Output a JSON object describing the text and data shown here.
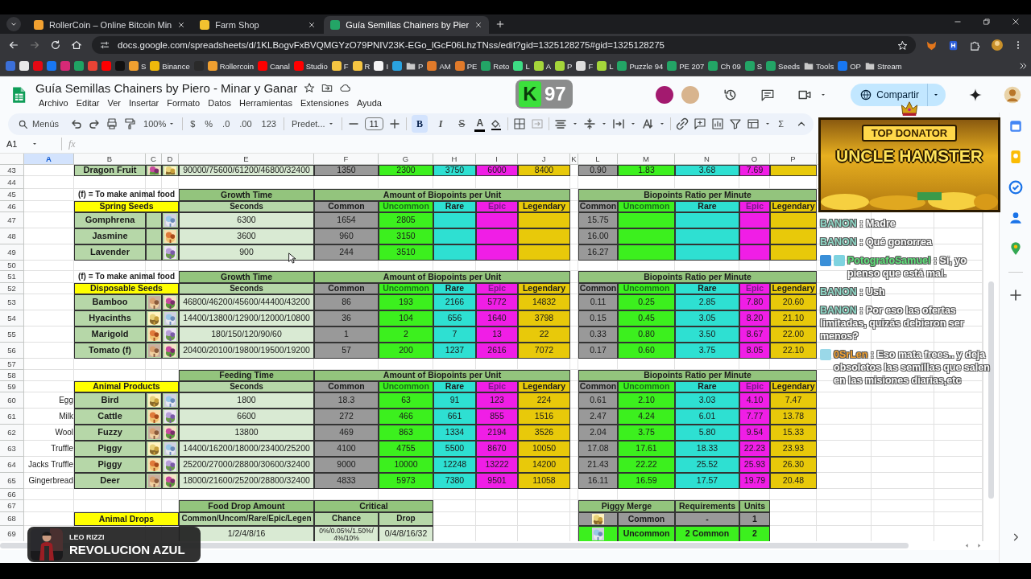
{
  "browser": {
    "tabs": [
      {
        "title": "RollerCoin – Online Bitcoin Min",
        "color": "#f0a030",
        "selected": false
      },
      {
        "title": "Farm Shop",
        "color": "#f2c230",
        "selected": false
      },
      {
        "title": "Guía Semillas Chainers by Pier",
        "color": "#23a566",
        "selected": true
      }
    ],
    "url": "docs.google.com/spreadsheets/d/1KLBogvFxBVQMGYzO79PNIV23K-EGo_lGcF06LhzTNss/edit?gid=1325128275#gid=1325128275",
    "bookmarks": [
      {
        "kind": "site",
        "color": "#3b6fd8"
      },
      {
        "kind": "site",
        "color": "#e8e8e8"
      },
      {
        "kind": "site",
        "color": "#e50914"
      },
      {
        "kind": "site",
        "color": "#1877f2"
      },
      {
        "kind": "site",
        "color": "#d62976"
      },
      {
        "kind": "site",
        "color": "#1fa463"
      },
      {
        "kind": "site",
        "color": "#ea4335"
      },
      {
        "kind": "site",
        "color": "#ff0000"
      },
      {
        "kind": "site",
        "color": "#111111"
      },
      {
        "kind": "site",
        "color": "#f0a030",
        "label": "S"
      },
      {
        "kind": "site",
        "color": "#f0b90b",
        "label": "Binance"
      },
      {
        "kind": "site",
        "color": "#2a2a2a"
      },
      {
        "kind": "site",
        "color": "#f0a030",
        "label": "Rollercoin"
      },
      {
        "kind": "site",
        "color": "#ff0000",
        "label": "Canal"
      },
      {
        "kind": "site",
        "color": "#ff0000",
        "label": "Studio"
      },
      {
        "kind": "site",
        "color": "#f5c542",
        "label": "F"
      },
      {
        "kind": "site",
        "color": "#f5c542",
        "label": "R"
      },
      {
        "kind": "site",
        "color": "#f4f4f4",
        "label": "I"
      },
      {
        "kind": "site",
        "color": "#2aa3e0"
      },
      {
        "kind": "folder",
        "color": "#c8c8c8",
        "label": "P"
      },
      {
        "kind": "site",
        "color": "#e07a2a",
        "label": "AM"
      },
      {
        "kind": "site",
        "color": "#e07a2a",
        "label": "PE"
      },
      {
        "kind": "site",
        "color": "#23a566",
        "label": "Reto"
      },
      {
        "kind": "site",
        "color": "#3ddc84",
        "label": "L"
      },
      {
        "kind": "site",
        "color": "#a5d63a",
        "label": "A"
      },
      {
        "kind": "site",
        "color": "#a5d63a",
        "label": "P"
      },
      {
        "kind": "site",
        "color": "#dddddd",
        "label": "F"
      },
      {
        "kind": "site",
        "color": "#a5d63a",
        "label": "L"
      },
      {
        "kind": "site",
        "color": "#23a566",
        "label": "Puzzle 94"
      },
      {
        "kind": "site",
        "color": "#23a566",
        "label": "PE 207"
      },
      {
        "kind": "site",
        "color": "#23a566",
        "label": "Ch 09"
      },
      {
        "kind": "site",
        "color": "#23a566",
        "label": "S"
      },
      {
        "kind": "site",
        "color": "#23a566",
        "label": "Seeds"
      },
      {
        "kind": "folder",
        "color": "#c8c8c8",
        "label": "Tools"
      },
      {
        "kind": "site",
        "color": "#1877f2",
        "label": "OP"
      },
      {
        "kind": "folder",
        "color": "#c8c8c8",
        "label": "Stream"
      }
    ]
  },
  "document": {
    "title": "Guía Semillas Chainers by Piero - Minar y Ganar",
    "menus": [
      "Archivo",
      "Editar",
      "Ver",
      "Insertar",
      "Formato",
      "Datos",
      "Herramientas",
      "Extensiones",
      "Ayuda"
    ],
    "collaborators": [
      {
        "color": "#a31a6f"
      },
      {
        "color": "#d8b48e"
      }
    ],
    "share": "Compartir"
  },
  "toolbar": {
    "search": "Menús",
    "zoom": "100%",
    "number_formats": [
      "$",
      "%",
      ".0",
      ".00",
      "123"
    ],
    "font": "Predet...",
    "font_size": "11",
    "styles": [
      {
        "label": "B",
        "selected": true
      },
      {
        "label": "I",
        "selected": false
      },
      {
        "label": "S",
        "selected": false
      },
      {
        "label": "A",
        "selected": false
      }
    ],
    "functions": "Σ"
  },
  "formula_bar": {
    "cell": "A1",
    "fx": "fx"
  },
  "sheet": {
    "columns": [
      {
        "letter": "A",
        "selected": true
      },
      {
        "letter": "B",
        "selected": false
      },
      {
        "letter": "C",
        "selected": false
      },
      {
        "letter": "D",
        "selected": false
      },
      {
        "letter": "E",
        "selected": false
      },
      {
        "letter": "F",
        "selected": false
      },
      {
        "letter": "G",
        "selected": false
      },
      {
        "letter": "H",
        "selected": false
      },
      {
        "letter": "I",
        "selected": false
      },
      {
        "letter": "J",
        "selected": false
      },
      {
        "letter": "K",
        "selected": false
      },
      {
        "letter": "L",
        "selected": false
      },
      {
        "letter": "M",
        "selected": false
      },
      {
        "letter": "N",
        "selected": false
      },
      {
        "letter": "O",
        "selected": false
      },
      {
        "letter": "P",
        "selected": false
      }
    ],
    "rows": [
      {
        "number": "43",
        "cells": [
          {
            "kind": "blank"
          },
          {
            "text": "Dragon Fruit",
            "kind": "name"
          },
          {
            "kind": "picture"
          },
          {
            "kind": "picture"
          },
          {
            "text": "90000/75600/61200/46800/32400",
            "kind": "val"
          },
          {
            "text": "1350",
            "kind": "common"
          },
          {
            "text": "2300",
            "kind": "uncommon"
          },
          {
            "text": "3750",
            "kind": "rare"
          },
          {
            "text": "6000",
            "kind": "epic"
          },
          {
            "text": "8400",
            "kind": "legendary"
          },
          {
            "kind": "blank"
          },
          {
            "text": "0.90",
            "kind": "common"
          },
          {
            "text": "1.83",
            "kind": "uncommon"
          },
          {
            "text": "3.68",
            "kind": "rare"
          },
          {
            "text": "7.69",
            "kind": "epic"
          },
          {
            "kind": "legendary"
          }
        ]
      },
      {
        "number": "44"
      },
      {
        "number": "45",
        "cells": [
          {
            "kind": "blank"
          },
          {
            "text": "(f) = To make animal food",
            "kind": "note"
          },
          {
            "kind": "merged"
          },
          {
            "kind": "merged"
          },
          {
            "text": "Growth Time",
            "kind": "title"
          },
          {
            "text": "Amount of Biopoints per Unit",
            "kind": "title"
          },
          {
            "kind": "merged"
          },
          {
            "kind": "merged"
          },
          {
            "kind": "merged"
          },
          {
            "kind": "merged"
          },
          {
            "kind": "blank"
          },
          {
            "text": "Biopoints Ratio per Minute",
            "kind": "title"
          },
          {
            "kind": "merged"
          },
          {
            "kind": "merged"
          },
          {
            "kind": "merged"
          },
          {
            "kind": "merged"
          }
        ]
      },
      {
        "number": "46",
        "cells": [
          {
            "kind": "blank"
          },
          {
            "text": "Spring Seeds",
            "kind": "yellow"
          },
          {
            "kind": "merged"
          },
          {
            "kind": "merged"
          },
          {
            "text": "Seconds",
            "kind": "sub"
          },
          {
            "text": "Common",
            "kind": "common-head"
          },
          {
            "text": "Uncommon",
            "kind": "uncommon-head"
          },
          {
            "text": "Rare",
            "kind": "rare-head"
          },
          {
            "text": "Epic",
            "kind": "epic-head"
          },
          {
            "text": "Legendary",
            "kind": "legendary-head"
          },
          {
            "kind": "blank"
          },
          {
            "text": "Common",
            "kind": "common-head"
          },
          {
            "text": "Uncommon",
            "kind": "uncommon-head"
          },
          {
            "text": "Rare",
            "kind": "rare-head"
          },
          {
            "text": "Epic",
            "kind": "epic-head"
          },
          {
            "text": "Legendary",
            "kind": "legendary-head"
          }
        ]
      },
      {
        "number": "47",
        "cells": [
          {
            "kind": "blank"
          },
          {
            "text": "Gomphrena",
            "kind": "name"
          },
          {
            "kind": "name"
          },
          {
            "kind": "picture"
          },
          {
            "text": "6300",
            "kind": "val"
          },
          {
            "text": "1654",
            "kind": "common"
          },
          {
            "text": "2805",
            "kind": "uncommon"
          },
          {
            "kind": "rare"
          },
          {
            "kind": "epic"
          },
          {
            "kind": "legendary"
          },
          {
            "kind": "blank"
          },
          {
            "text": "15.75",
            "kind": "common"
          },
          {
            "kind": "uncommon"
          },
          {
            "kind": "rare"
          },
          {
            "kind": "epic"
          },
          {
            "kind": "legendary"
          }
        ]
      },
      {
        "number": "48",
        "cells": [
          {
            "kind": "blank"
          },
          {
            "text": "Jasmine",
            "kind": "name"
          },
          {
            "kind": "name"
          },
          {
            "kind": "picture"
          },
          {
            "text": "3600",
            "kind": "val"
          },
          {
            "text": "960",
            "kind": "common"
          },
          {
            "text": "3150",
            "kind": "uncommon"
          },
          {
            "kind": "rare"
          },
          {
            "kind": "epic"
          },
          {
            "kind": "legendary"
          },
          {
            "kind": "blank"
          },
          {
            "text": "16.00",
            "kind": "common"
          },
          {
            "kind": "uncommon"
          },
          {
            "kind": "rare"
          },
          {
            "kind": "epic"
          },
          {
            "kind": "legendary"
          }
        ]
      },
      {
        "number": "49",
        "cells": [
          {
            "kind": "blank"
          },
          {
            "text": "Lavender",
            "kind": "name"
          },
          {
            "kind": "name"
          },
          {
            "kind": "picture"
          },
          {
            "text": "900",
            "kind": "val"
          },
          {
            "text": "244",
            "kind": "common"
          },
          {
            "text": "3510",
            "kind": "uncommon"
          },
          {
            "kind": "rare"
          },
          {
            "kind": "epic"
          },
          {
            "kind": "legendary"
          },
          {
            "kind": "blank"
          },
          {
            "text": "16.27",
            "kind": "common"
          },
          {
            "kind": "uncommon"
          },
          {
            "kind": "rare"
          },
          {
            "kind": "epic"
          },
          {
            "kind": "legendary"
          }
        ]
      },
      {
        "number": "50"
      },
      {
        "number": "51",
        "cells": [
          {
            "kind": "blank"
          },
          {
            "text": "(f) = To make animal food",
            "kind": "note"
          },
          {
            "kind": "merged"
          },
          {
            "kind": "merged"
          },
          {
            "text": "Growth Time",
            "kind": "title"
          },
          {
            "text": "Amount of Biopoints per Unit",
            "kind": "title"
          },
          {
            "kind": "merged"
          },
          {
            "kind": "merged"
          },
          {
            "kind": "merged"
          },
          {
            "kind": "merged"
          },
          {
            "kind": "blank"
          },
          {
            "text": "Biopoints Ratio per Minute",
            "kind": "title"
          },
          {
            "kind": "merged"
          },
          {
            "kind": "merged"
          },
          {
            "kind": "merged"
          },
          {
            "kind": "merged"
          }
        ]
      },
      {
        "number": "52",
        "cells": [
          {
            "kind": "blank"
          },
          {
            "text": "Disposable Seeds",
            "kind": "yellow"
          },
          {
            "kind": "merged"
          },
          {
            "kind": "merged"
          },
          {
            "text": "Seconds",
            "kind": "sub"
          },
          {
            "text": "Common",
            "kind": "common-head"
          },
          {
            "text": "Uncommon",
            "kind": "uncommon-head"
          },
          {
            "text": "Rare",
            "kind": "rare-head"
          },
          {
            "text": "Epic",
            "kind": "epic-head"
          },
          {
            "text": "Legendary",
            "kind": "legendary-head"
          },
          {
            "kind": "blank"
          },
          {
            "text": "Common",
            "kind": "common-head"
          },
          {
            "text": "Uncommon",
            "kind": "uncommon-head"
          },
          {
            "text": "Rare",
            "kind": "rare-head"
          },
          {
            "text": "Epic",
            "kind": "epic-head"
          },
          {
            "text": "Legendary",
            "kind": "legendary-head"
          }
        ]
      },
      {
        "number": "53",
        "cells": [
          {
            "kind": "blank"
          },
          {
            "text": "Bamboo",
            "kind": "name"
          },
          {
            "kind": "picture"
          },
          {
            "kind": "picture"
          },
          {
            "text": "46800/46200/45600/44400/43200",
            "kind": "val"
          },
          {
            "text": "86",
            "kind": "common"
          },
          {
            "text": "193",
            "kind": "uncommon"
          },
          {
            "text": "2166",
            "kind": "rare"
          },
          {
            "text": "5772",
            "kind": "epic"
          },
          {
            "text": "14832",
            "kind": "legendary"
          },
          {
            "kind": "blank"
          },
          {
            "text": "0.11",
            "kind": "common"
          },
          {
            "text": "0.25",
            "kind": "uncommon"
          },
          {
            "text": "2.85",
            "kind": "rare"
          },
          {
            "text": "7.80",
            "kind": "epic"
          },
          {
            "text": "20.60",
            "kind": "legendary"
          }
        ]
      },
      {
        "number": "54",
        "cells": [
          {
            "kind": "blank"
          },
          {
            "text": "Hyacinths",
            "kind": "name"
          },
          {
            "kind": "picture"
          },
          {
            "kind": "picture"
          },
          {
            "text": "14400/13800/12900/12000/10800",
            "kind": "val"
          },
          {
            "text": "36",
            "kind": "common"
          },
          {
            "text": "104",
            "kind": "uncommon"
          },
          {
            "text": "656",
            "kind": "rare"
          },
          {
            "text": "1640",
            "kind": "epic"
          },
          {
            "text": "3798",
            "kind": "legendary"
          },
          {
            "kind": "blank"
          },
          {
            "text": "0.15",
            "kind": "common"
          },
          {
            "text": "0.45",
            "kind": "uncommon"
          },
          {
            "text": "3.05",
            "kind": "rare"
          },
          {
            "text": "8.20",
            "kind": "epic"
          },
          {
            "text": "21.10",
            "kind": "legendary"
          }
        ]
      },
      {
        "number": "55",
        "cells": [
          {
            "kind": "blank"
          },
          {
            "text": "Marigold",
            "kind": "name"
          },
          {
            "kind": "picture"
          },
          {
            "kind": "picture"
          },
          {
            "text": "180/150/120/90/60",
            "kind": "val"
          },
          {
            "text": "1",
            "kind": "common"
          },
          {
            "text": "2",
            "kind": "uncommon"
          },
          {
            "text": "7",
            "kind": "rare"
          },
          {
            "text": "13",
            "kind": "epic"
          },
          {
            "text": "22",
            "kind": "legendary"
          },
          {
            "kind": "blank"
          },
          {
            "text": "0.33",
            "kind": "common"
          },
          {
            "text": "0.80",
            "kind": "uncommon"
          },
          {
            "text": "3.50",
            "kind": "rare"
          },
          {
            "text": "8.67",
            "kind": "epic"
          },
          {
            "text": "22.00",
            "kind": "legendary"
          }
        ]
      },
      {
        "number": "56",
        "cells": [
          {
            "kind": "blank"
          },
          {
            "text": "Tomato (f)",
            "kind": "name"
          },
          {
            "kind": "picture"
          },
          {
            "kind": "picture"
          },
          {
            "text": "20400/20100/19800/19500/19200",
            "kind": "val"
          },
          {
            "text": "57",
            "kind": "common"
          },
          {
            "text": "200",
            "kind": "uncommon"
          },
          {
            "text": "1237",
            "kind": "rare"
          },
          {
            "text": "2616",
            "kind": "epic"
          },
          {
            "text": "7072",
            "kind": "legendary"
          },
          {
            "kind": "blank"
          },
          {
            "text": "0.17",
            "kind": "common"
          },
          {
            "text": "0.60",
            "kind": "uncommon"
          },
          {
            "text": "3.75",
            "kind": "rare"
          },
          {
            "text": "8.05",
            "kind": "epic"
          },
          {
            "text": "22.10",
            "kind": "legendary"
          }
        ]
      },
      {
        "number": "57"
      },
      {
        "number": "58",
        "cells": [
          {
            "kind": "blank"
          },
          {
            "kind": "blank"
          },
          {
            "kind": "blank"
          },
          {
            "kind": "blank"
          },
          {
            "text": "Feeding Time",
            "kind": "title"
          },
          {
            "text": "Amount of Biopoints per Unit",
            "kind": "title"
          },
          {
            "kind": "merged"
          },
          {
            "kind": "merged"
          },
          {
            "kind": "merged"
          },
          {
            "kind": "merged"
          },
          {
            "kind": "blank"
          },
          {
            "text": "Biopoints Ratio per Minute",
            "kind": "title"
          },
          {
            "kind": "merged"
          },
          {
            "kind": "merged"
          },
          {
            "kind": "merged"
          },
          {
            "kind": "merged"
          }
        ]
      },
      {
        "number": "59",
        "cells": [
          {
            "kind": "blank"
          },
          {
            "text": "Animal Products",
            "kind": "yellow"
          },
          {
            "kind": "merged"
          },
          {
            "kind": "merged"
          },
          {
            "text": "Seconds",
            "kind": "sub"
          },
          {
            "text": "Common",
            "kind": "common-head"
          },
          {
            "text": "Uncommon",
            "kind": "uncommon-head"
          },
          {
            "text": "Rare",
            "kind": "rare-head"
          },
          {
            "text": "Epic",
            "kind": "epic-head"
          },
          {
            "text": "Legendary",
            "kind": "legendary-head"
          },
          {
            "kind": "blank"
          },
          {
            "text": "Common",
            "kind": "common-head"
          },
          {
            "text": "Uncommon",
            "kind": "uncommon-head"
          },
          {
            "text": "Rare",
            "kind": "rare-head"
          },
          {
            "text": "Epic",
            "kind": "epic-head"
          },
          {
            "text": "Legendary",
            "kind": "legendary-head"
          }
        ]
      },
      {
        "number": "60",
        "cells": [
          {
            "text": "Egg",
            "kind": "label"
          },
          {
            "text": "Bird",
            "kind": "name"
          },
          {
            "kind": "picture"
          },
          {
            "kind": "picture"
          },
          {
            "text": "1800",
            "kind": "val"
          },
          {
            "text": "18.3",
            "kind": "common"
          },
          {
            "text": "63",
            "kind": "uncommon"
          },
          {
            "text": "91",
            "kind": "rare"
          },
          {
            "text": "123",
            "kind": "epic"
          },
          {
            "text": "224",
            "kind": "legendary"
          },
          {
            "kind": "blank"
          },
          {
            "text": "0.61",
            "kind": "common"
          },
          {
            "text": "2.10",
            "kind": "uncommon"
          },
          {
            "text": "3.03",
            "kind": "rare"
          },
          {
            "text": "4.10",
            "kind": "epic"
          },
          {
            "text": "7.47",
            "kind": "legendary"
          }
        ]
      },
      {
        "number": "61",
        "cells": [
          {
            "text": "Milk",
            "kind": "label"
          },
          {
            "text": "Cattle",
            "kind": "name"
          },
          {
            "kind": "picture"
          },
          {
            "kind": "picture"
          },
          {
            "text": "6600",
            "kind": "val"
          },
          {
            "text": "272",
            "kind": "common"
          },
          {
            "text": "466",
            "kind": "uncommon"
          },
          {
            "text": "661",
            "kind": "rare"
          },
          {
            "text": "855",
            "kind": "epic"
          },
          {
            "text": "1516",
            "kind": "legendary"
          },
          {
            "kind": "blank"
          },
          {
            "text": "2.47",
            "kind": "common"
          },
          {
            "text": "4.24",
            "kind": "uncommon"
          },
          {
            "text": "6.01",
            "kind": "rare"
          },
          {
            "text": "7.77",
            "kind": "epic"
          },
          {
            "text": "13.78",
            "kind": "legendary"
          }
        ]
      },
      {
        "number": "62",
        "cells": [
          {
            "text": "Wool",
            "kind": "label"
          },
          {
            "text": "Fuzzy",
            "kind": "name"
          },
          {
            "kind": "picture"
          },
          {
            "kind": "picture"
          },
          {
            "text": "13800",
            "kind": "val"
          },
          {
            "text": "469",
            "kind": "common"
          },
          {
            "text": "863",
            "kind": "uncommon"
          },
          {
            "text": "1334",
            "kind": "rare"
          },
          {
            "text": "2194",
            "kind": "epic"
          },
          {
            "text": "3526",
            "kind": "legendary"
          },
          {
            "kind": "blank"
          },
          {
            "text": "2.04",
            "kind": "common"
          },
          {
            "text": "3.75",
            "kind": "uncommon"
          },
          {
            "text": "5.80",
            "kind": "rare"
          },
          {
            "text": "9.54",
            "kind": "epic"
          },
          {
            "text": "15.33",
            "kind": "legendary"
          }
        ]
      },
      {
        "number": "63",
        "cells": [
          {
            "text": "Truffle",
            "kind": "label"
          },
          {
            "text": "Piggy",
            "kind": "name"
          },
          {
            "kind": "picture"
          },
          {
            "kind": "picture"
          },
          {
            "text": "14400/16200/18000/23400/25200",
            "kind": "val"
          },
          {
            "text": "4100",
            "kind": "common"
          },
          {
            "text": "4755",
            "kind": "uncommon"
          },
          {
            "text": "5500",
            "kind": "rare"
          },
          {
            "text": "8670",
            "kind": "epic"
          },
          {
            "text": "10050",
            "kind": "legendary"
          },
          {
            "kind": "blank"
          },
          {
            "text": "17.08",
            "kind": "common"
          },
          {
            "text": "17.61",
            "kind": "uncommon"
          },
          {
            "text": "18.33",
            "kind": "rare"
          },
          {
            "text": "22.23",
            "kind": "epic"
          },
          {
            "text": "23.93",
            "kind": "legendary"
          }
        ]
      },
      {
        "number": "64",
        "cells": [
          {
            "text": "Jacks Truffle",
            "kind": "label"
          },
          {
            "text": "Piggy",
            "kind": "name"
          },
          {
            "kind": "picture"
          },
          {
            "kind": "picture"
          },
          {
            "text": "25200/27000/28800/30600/32400",
            "kind": "val"
          },
          {
            "text": "9000",
            "kind": "common"
          },
          {
            "text": "10000",
            "kind": "uncommon"
          },
          {
            "text": "12248",
            "kind": "rare"
          },
          {
            "text": "13222",
            "kind": "epic"
          },
          {
            "text": "14200",
            "kind": "legendary"
          },
          {
            "kind": "blank"
          },
          {
            "text": "21.43",
            "kind": "common"
          },
          {
            "text": "22.22",
            "kind": "uncommon"
          },
          {
            "text": "25.52",
            "kind": "rare"
          },
          {
            "text": "25.93",
            "kind": "epic"
          },
          {
            "text": "26.30",
            "kind": "legendary"
          }
        ]
      },
      {
        "number": "65",
        "cells": [
          {
            "text": "Gingerbread",
            "kind": "label"
          },
          {
            "text": "Deer",
            "kind": "name"
          },
          {
            "kind": "picture"
          },
          {
            "kind": "picture"
          },
          {
            "text": "18000/21600/25200/28800/32400",
            "kind": "val"
          },
          {
            "text": "4833",
            "kind": "common"
          },
          {
            "text": "5973",
            "kind": "uncommon"
          },
          {
            "text": "7380",
            "kind": "rare"
          },
          {
            "text": "9501",
            "kind": "epic"
          },
          {
            "text": "11058",
            "kind": "legendary"
          },
          {
            "kind": "blank"
          },
          {
            "text": "16.11",
            "kind": "common"
          },
          {
            "text": "16.59",
            "kind": "uncommon"
          },
          {
            "text": "17.57",
            "kind": "rare"
          },
          {
            "text": "19.79",
            "kind": "epic"
          },
          {
            "text": "20.48",
            "kind": "legendary"
          }
        ]
      },
      {
        "number": "66"
      },
      {
        "number": "67",
        "cells": [
          {
            "kind": "blank"
          },
          {
            "kind": "blank"
          },
          {
            "kind": "blank"
          },
          {
            "kind": "blank"
          },
          {
            "text": "Food Drop Amount",
            "kind": "title"
          },
          {
            "text": "Critical",
            "kind": "title"
          },
          {
            "kind": "merged"
          },
          {
            "kind": "blank"
          },
          {
            "kind": "blank"
          },
          {
            "kind": "blank"
          },
          {
            "kind": "blank"
          },
          {
            "text": "Piggy Merge",
            "kind": "title"
          },
          {
            "kind": "merged"
          },
          {
            "text": "Requirements",
            "kind": "title"
          },
          {
            "text": "Units",
            "kind": "title"
          }
        ]
      },
      {
        "number": "68",
        "cells": [
          {
            "kind": "blank"
          },
          {
            "text": "Animal Drops",
            "kind": "yellow"
          },
          {
            "kind": "merged"
          },
          {
            "kind": "merged"
          },
          {
            "text": "Common/Uncom/Rare/Epic/Legen",
            "kind": "sub"
          },
          {
            "text": "Chance",
            "kind": "sub"
          },
          {
            "text": "Drop",
            "kind": "sub"
          },
          {
            "kind": "blank"
          },
          {
            "kind": "blank"
          },
          {
            "kind": "blank"
          },
          {
            "kind": "blank"
          },
          {
            "kind": "picture-common"
          },
          {
            "text": "Common",
            "kind": "common-head"
          },
          {
            "text": "-",
            "kind": "common-head"
          },
          {
            "text": "1",
            "kind": "common-head"
          }
        ]
      },
      {
        "number": "69",
        "cells": [
          {
            "kind": "blank"
          },
          {
            "kind": "blank"
          },
          {
            "kind": "blank"
          },
          {
            "kind": "blank"
          },
          {
            "text": "1/2/4/8/16",
            "kind": "val"
          },
          {
            "text": "0%/0.05%/1.50%/4%/10%",
            "kind": "val-small"
          },
          {
            "text": "0/4/8/16/32",
            "kind": "val"
          },
          {
            "kind": "blank"
          },
          {
            "kind": "blank"
          },
          {
            "kind": "blank"
          },
          {
            "kind": "blank"
          },
          {
            "kind": "picture-uncommon"
          },
          {
            "text": "Uncommon",
            "kind": "strong"
          },
          {
            "text": "2 Common",
            "kind": "strong"
          },
          {
            "text": "2",
            "kind": "strong"
          }
        ]
      }
    ]
  },
  "chat": {
    "messages": [
      {
        "user": "BANON",
        "color": "#8fd9c8",
        "text": " : Madre"
      },
      {
        "user": "BANON",
        "color": "#8fd9c8",
        "text": " : Qué gonorrea"
      },
      {
        "user": "PotografoSamuel",
        "color": "#5ee07a",
        "text": " : Sí, yo pienso que está mal.",
        "badges": [
          {
            "color": "#3a8fd8"
          },
          {
            "color": "#7ed3e0"
          }
        ]
      },
      {
        "user": "BANON",
        "color": "#8fd9c8",
        "text": " : Ush"
      },
      {
        "user": "BANON",
        "color": "#8fd9c8",
        "text": " : Por eso las ofertas limitadas, quizás debieron ser menos?"
      },
      {
        "user": "0SrLen",
        "color": "#f0a030",
        "text": " : Eso mata frees.. y deja obsoletos las semillas que salen en las misiones diarias,etc",
        "badges": [
          {
            "color": "#9ad8e8"
          }
        ]
      }
    ]
  },
  "donator": {
    "label": "TOP DONATOR",
    "name": "UNCLE HAMSTER"
  },
  "channel_badge": {
    "letter": "K",
    "number": "97"
  },
  "now_playing": {
    "artist": "LEO RIZZI",
    "title": "REVOLUCION AZUL"
  }
}
